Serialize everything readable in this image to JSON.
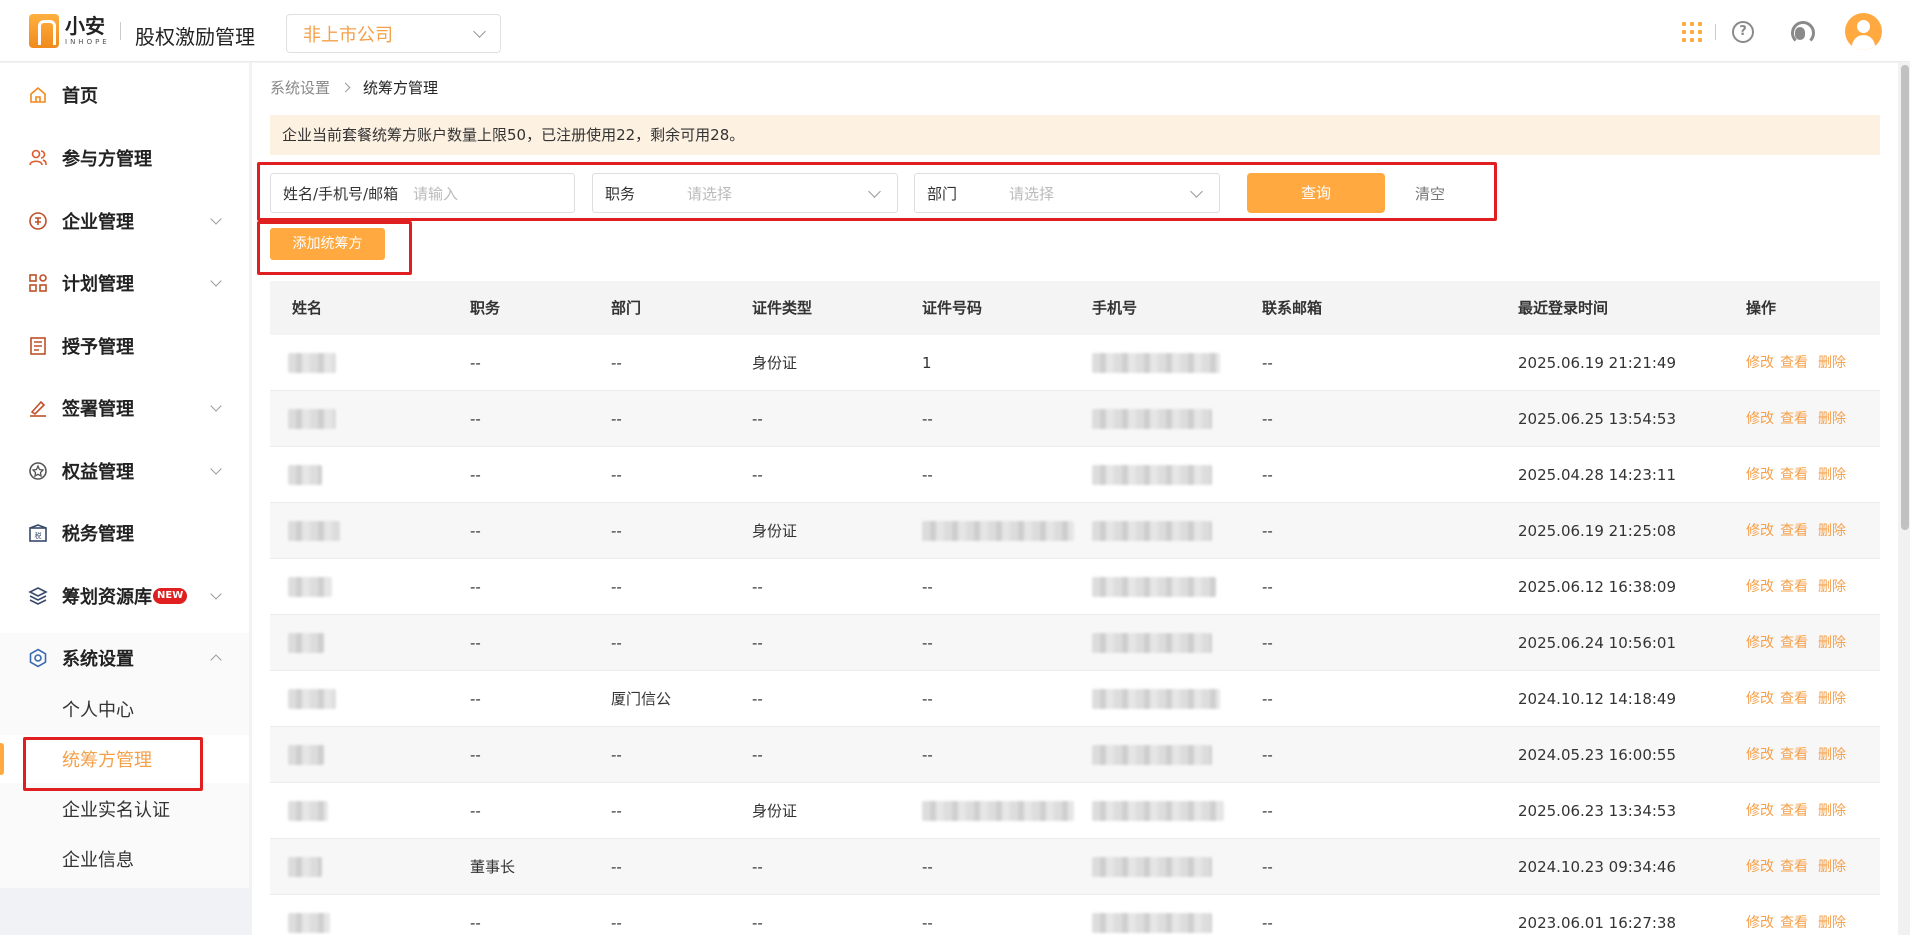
{
  "header": {
    "logo_name": "小安",
    "logo_sub": "INHOPE",
    "app_title": "股权激励管理",
    "company_select": "非上市公司"
  },
  "sidebar": {
    "items": [
      {
        "label": "首页",
        "icon": "home-icon"
      },
      {
        "label": "参与方管理",
        "icon": "users-icon"
      },
      {
        "label": "企业管理",
        "icon": "enterprise-icon"
      },
      {
        "label": "计划管理",
        "icon": "plan-icon"
      },
      {
        "label": "授予管理",
        "icon": "grant-icon"
      },
      {
        "label": "签署管理",
        "icon": "sign-icon"
      },
      {
        "label": "权益管理",
        "icon": "equity-icon"
      },
      {
        "label": "税务管理",
        "icon": "tax-icon"
      },
      {
        "label": "筹划资源库",
        "icon": "layers-icon",
        "badge": "NEW"
      },
      {
        "label": "系统设置",
        "icon": "settings-icon"
      }
    ],
    "sub_items": [
      "个人中心",
      "统筹方管理",
      "企业实名认证",
      "企业信息"
    ]
  },
  "breadcrumb": {
    "parent": "系统设置",
    "current": "统筹方管理"
  },
  "notice": "企业当前套餐统筹方账户数量上限50，已注册使用22，剩余可用28。",
  "filters": {
    "name_label": "姓名/手机号/邮箱",
    "name_placeholder": "请输入",
    "position_label": "职务",
    "position_placeholder": "请选择",
    "dept_label": "部门",
    "dept_placeholder": "请选择",
    "query_button": "查询",
    "clear_button": "清空"
  },
  "add_button": "添加统筹方",
  "table": {
    "columns": [
      "姓名",
      "职务",
      "部门",
      "证件类型",
      "证件号码",
      "手机号",
      "联系邮箱",
      "最近登录时间",
      "操作"
    ],
    "actions": [
      "修改",
      "查看",
      "删除"
    ],
    "rows": [
      {
        "position": "--",
        "dept": "--",
        "id_type": "身份证",
        "id_no": "1",
        "email": "--",
        "last_login": "2025.06.19 21:21:49"
      },
      {
        "position": "--",
        "dept": "--",
        "id_type": "--",
        "id_no": "--",
        "email": "--",
        "last_login": "2025.06.25 13:54:53"
      },
      {
        "position": "--",
        "dept": "--",
        "id_type": "--",
        "id_no": "--",
        "email": "--",
        "last_login": "2025.04.28 14:23:11"
      },
      {
        "position": "--",
        "dept": "--",
        "id_type": "身份证",
        "id_no": "",
        "email": "--",
        "last_login": "2025.06.19 21:25:08"
      },
      {
        "position": "--",
        "dept": "--",
        "id_type": "--",
        "id_no": "--",
        "email": "--",
        "last_login": "2025.06.12 16:38:09"
      },
      {
        "position": "--",
        "dept": "--",
        "id_type": "--",
        "id_no": "--",
        "email": "--",
        "last_login": "2025.06.24 10:56:01"
      },
      {
        "position": "--",
        "dept": "厦门信公",
        "id_type": "--",
        "id_no": "--",
        "email": "--",
        "last_login": "2024.10.12 14:18:49"
      },
      {
        "position": "--",
        "dept": "--",
        "id_type": "--",
        "id_no": "--",
        "email": "--",
        "last_login": "2024.05.23 16:00:55"
      },
      {
        "position": "--",
        "dept": "--",
        "id_type": "身份证",
        "id_no": "",
        "email": "--",
        "last_login": "2025.06.23 13:34:53"
      },
      {
        "position": "董事长",
        "dept": "--",
        "id_type": "--",
        "id_no": "--",
        "email": "--",
        "last_login": "2024.10.23 09:34:46"
      },
      {
        "position": "--",
        "dept": "--",
        "id_type": "--",
        "id_no": "--",
        "email": "--",
        "last_login": "2023.06.01 16:27:38"
      }
    ]
  },
  "colors": {
    "accent": "#ffa940",
    "accent_text": "#f5a04a",
    "highlight": "#e02020",
    "notice_bg": "#fdf1e2"
  }
}
